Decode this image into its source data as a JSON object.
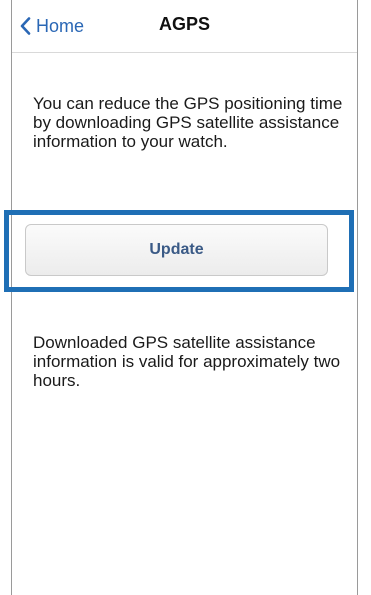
{
  "navbar": {
    "back_label": "Home",
    "title": "AGPS",
    "back_icon": "chevron-left-icon",
    "accent_color": "#2a67b5"
  },
  "main": {
    "intro_text": "You can reduce the GPS positioning time by downloading GPS satellite assistance information to your watch.",
    "update_button_label": "Update",
    "note_text": "Downloaded GPS satellite assistance information is valid for approximately two hours.",
    "highlight_color": "#1f6fb5"
  }
}
